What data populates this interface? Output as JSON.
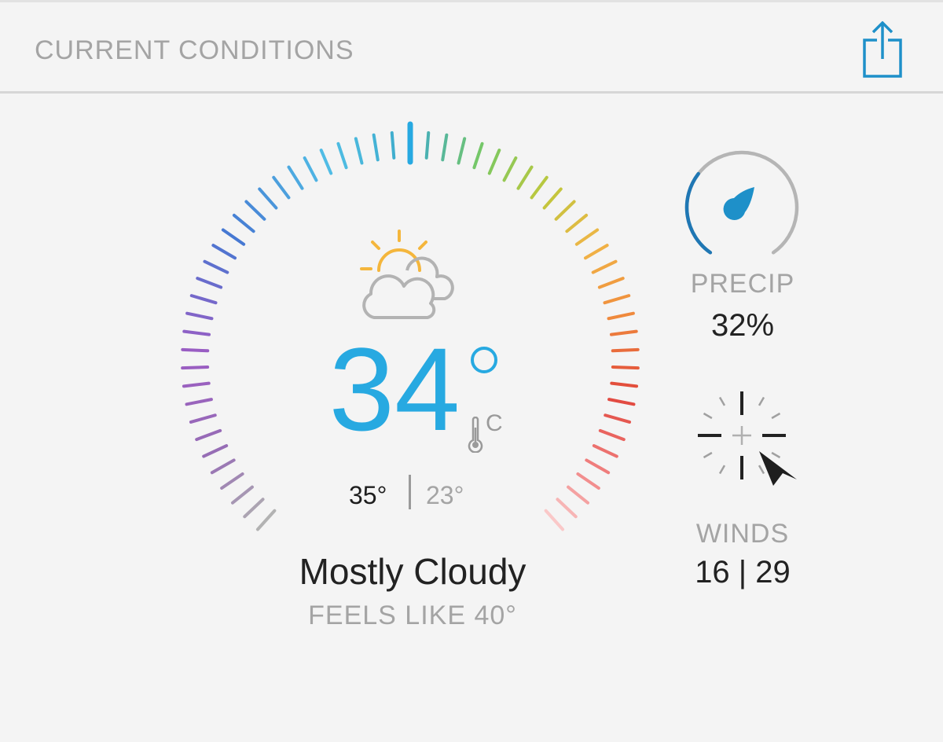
{
  "header": {
    "title": "CURRENT CONDITIONS",
    "share_icon": "share-icon"
  },
  "gauge": {
    "current_temp_marker_level": 0.5
  },
  "current": {
    "weather_icon": "partly-cloudy-icon",
    "temperature": "34",
    "unit": "C",
    "high": "35°",
    "low": "23°",
    "condition": "Mostly Cloudy",
    "feels_like": "FEELS LIKE 40°"
  },
  "precip": {
    "label": "PRECIP",
    "value": "32%",
    "level": 0.32,
    "icon": "raindrop-icon"
  },
  "winds": {
    "label": "WINDS",
    "value": "16 | 29",
    "icon": "wind-compass-icon"
  },
  "colors": {
    "accent": "#27a9e1",
    "dial_blue": "#1f77b4",
    "sun": "#f4b63c",
    "cloud": "#b3b3b3"
  }
}
